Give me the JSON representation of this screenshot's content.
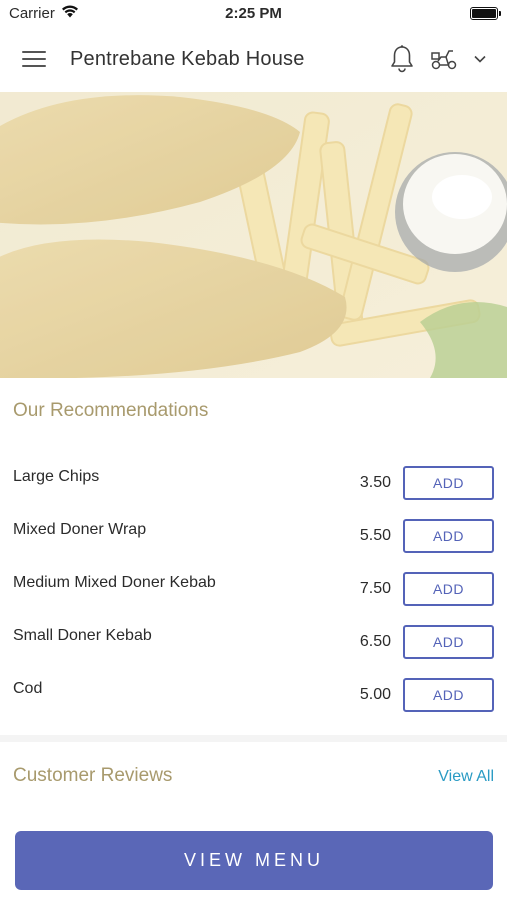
{
  "status_bar": {
    "carrier": "Carrier",
    "time": "2:25 PM",
    "wifi_icon": "wifi-icon",
    "battery_icon": "battery-icon"
  },
  "header": {
    "menu_icon": "hamburger-menu-icon",
    "title": "Pentrebane Kebab House",
    "bell_icon": "bell-icon",
    "delivery_icon": "scooter-icon",
    "dropdown_icon": "chevron-down-icon"
  },
  "hero": {
    "image_icon": "fish-and-chips-image"
  },
  "recommendations": {
    "title": "Our Recommendations",
    "add_label": "ADD",
    "items": [
      {
        "name": "Large Chips",
        "price": "3.50"
      },
      {
        "name": "Mixed Doner Wrap",
        "price": "5.50"
      },
      {
        "name": "Medium Mixed Doner Kebab",
        "price": "7.50"
      },
      {
        "name": "Small Doner Kebab",
        "price": "6.50"
      },
      {
        "name": "Cod",
        "price": "5.00"
      }
    ]
  },
  "reviews": {
    "title": "Customer Reviews",
    "view_all": "View All"
  },
  "footer": {
    "view_menu": "VIEW MENU"
  },
  "colors": {
    "accent": "#5a67b7",
    "section_title": "#a89a6d",
    "link": "#2a9bc4"
  }
}
